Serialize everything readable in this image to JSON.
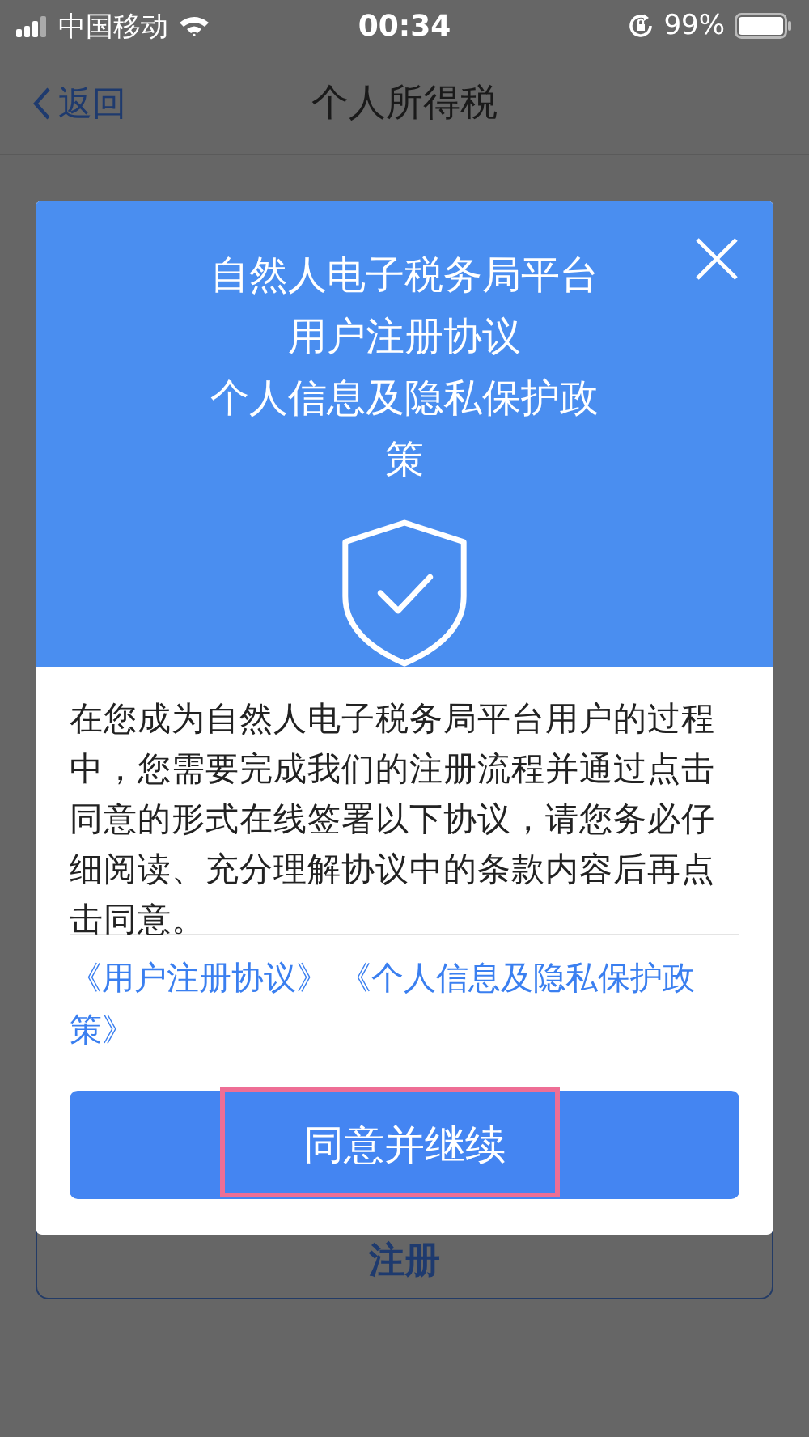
{
  "status_bar": {
    "carrier": "中国移动",
    "time": "00:34",
    "battery": "99%"
  },
  "nav_bar": {
    "back": "返回",
    "title": "个人所得税"
  },
  "background_button": {
    "label": "注册"
  },
  "dialog": {
    "title_lines": [
      "自然人电子税务局平台",
      "用户注册协议",
      "个人信息及隐私保护政策"
    ],
    "body": "在您成为自然人电子税务局平台用户的过程中，您需要完成我们的注册流程并通过点击同意的形式在线签署以下协议，请您务必仔细阅读、充分理解协议中的条款内容后再点击同意。",
    "links": [
      "《用户注册协议》",
      "《个人信息及隐私保护政策》"
    ],
    "confirm_button": {
      "label": "同意并继续",
      "highlighted": true
    }
  }
}
